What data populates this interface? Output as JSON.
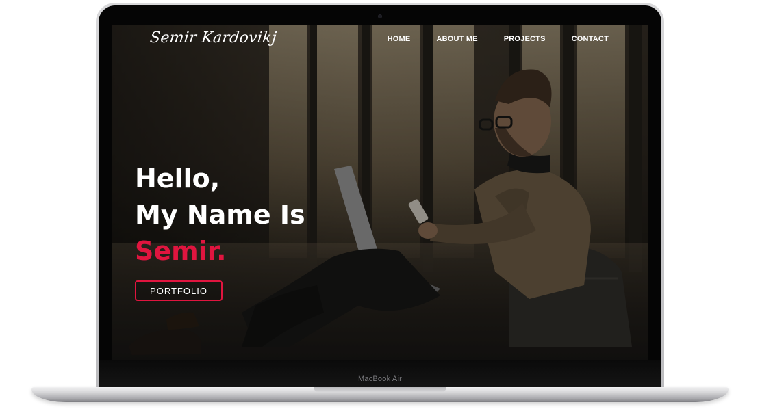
{
  "device": {
    "model_label": "MacBook Air"
  },
  "site": {
    "logo_text": "Semir Kardovikj",
    "nav": {
      "home": "HOME",
      "about": "ABOUT ME",
      "projects": "PROJECTS",
      "contact": "CONTACT"
    },
    "hero": {
      "line1": "Hello,",
      "line2": "My Name Is",
      "name": "Semir.",
      "cta_label": "PORTFOLIO"
    }
  },
  "colors": {
    "accent": "#e0153f",
    "text": "#ffffff"
  }
}
